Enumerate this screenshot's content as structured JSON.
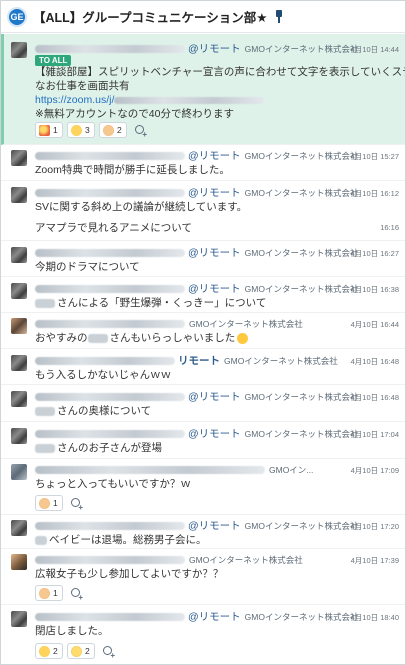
{
  "header": {
    "room_icon": "GE",
    "title": "【ALL】グループコミュニケーション部★",
    "pin_icon": "pin-icon"
  },
  "messages": [
    {
      "time": "4月10日 14:44",
      "mention": "@リモート",
      "company": "GMOインターネット株式会社",
      "to_badge": "TO ALL",
      "lines": [
        "【雑談部屋】スピリットベンチャー宣言の声に合わせて文字を表示していくステキ",
        "なお仕事を画面共有"
      ],
      "link": "https://zoom.us/j/",
      "note": "※無料アカウントなので40分で終わります",
      "reactions": [
        {
          "icon": "party-icon",
          "count": "1"
        },
        {
          "icon": "wow-icon",
          "count": "3"
        },
        {
          "icon": "thumbs-up-icon",
          "count": "2"
        }
      ]
    },
    {
      "time": "4月10日 15:27",
      "mention": "@リモート",
      "company": "GMOインターネット株式会社",
      "text": "Zoom特典で時間が勝手に延長しました。"
    },
    {
      "time": "4月10日 16:12",
      "mention": "@リモート",
      "company": "GMOインターネット株式会社",
      "text": "SVに関する斜め上の議論が継続しています。"
    },
    {
      "time": "16:16",
      "text": "アマプラで見れるアニメについて"
    },
    {
      "time": "4月10日 16:27",
      "mention": "@リモート",
      "company": "GMOインターネット株式会社",
      "text": "今期のドラマについて"
    },
    {
      "time": "4月10日 16:38",
      "mention": "@リモート",
      "company": "GMOインターネット株式会社",
      "text": "さんによる「野生爆弾・くっきー」について"
    },
    {
      "time": "4月10日 16:44",
      "company": "GMOインターネット株式会社",
      "text_a": "おやすみの",
      "text_b": "さんもいらっしゃいました"
    },
    {
      "time": "4月10日 16:48",
      "mention": "リモート",
      "company": "GMOインターネット株式会社",
      "text": "もう入るしかないじゃんｗｗ"
    },
    {
      "time": "4月10日 16:48",
      "mention": "@リモート",
      "company": "GMOインターネット株式会社",
      "text": "さんの奥様について"
    },
    {
      "time": "4月10日 17:04",
      "mention": "@リモート",
      "company": "GMOインターネット株式会社",
      "text": "さんのお子さんが登場"
    },
    {
      "time": "4月10日 17:09",
      "company": "GMOイン...",
      "text": "ちょっと入ってもいいですか？ｗ",
      "reactions": [
        {
          "icon": "thumbs-up-icon",
          "count": "1"
        }
      ]
    },
    {
      "time": "4月10日 17:20",
      "mention": "@リモート",
      "company": "GMOインターネット株式会社",
      "text": "ベイビーは退場。総務男子会に。"
    },
    {
      "time": "4月10日 17:39",
      "company": "GMOインターネット株式会社",
      "text": "広報女子も少し参加してよいですか？？",
      "reactions": [
        {
          "icon": "thumbs-up-icon",
          "count": "1"
        }
      ]
    },
    {
      "time": "4月10日 18:40",
      "mention": "@リモート",
      "company": "GMOインターネット株式会社",
      "text": "閉店しました。",
      "reactions": [
        {
          "icon": "wow-icon",
          "count": "2"
        },
        {
          "icon": "bow-icon",
          "count": "2"
        }
      ]
    }
  ]
}
